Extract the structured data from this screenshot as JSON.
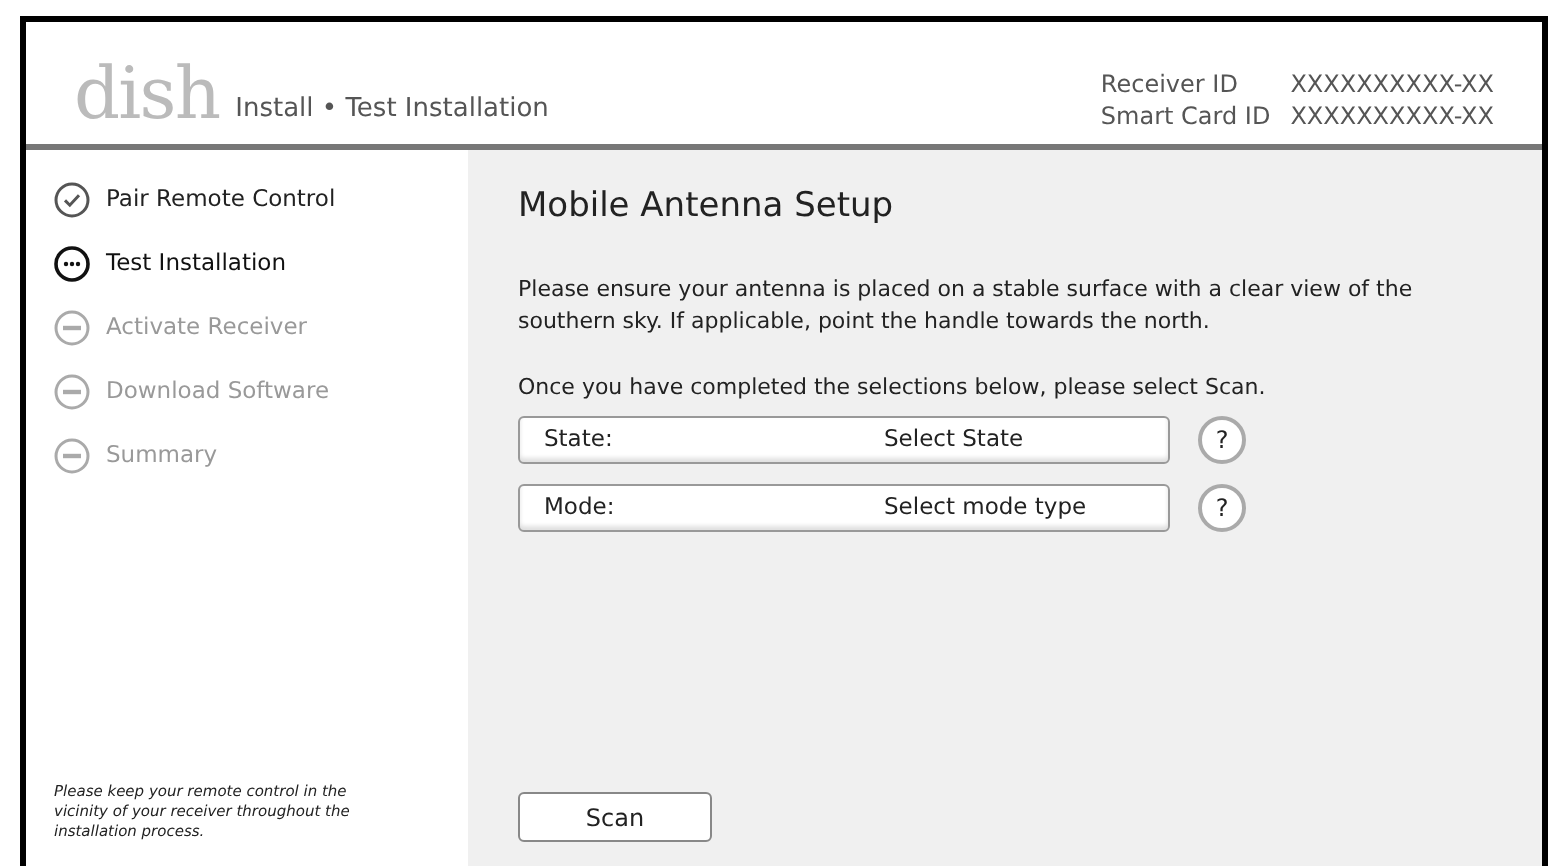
{
  "header": {
    "logo": "dish",
    "breadcrumb": "Install • Test Installation",
    "ids": [
      {
        "label": "Receiver ID",
        "value": "XXXXXXXXXX-XX"
      },
      {
        "label": "Smart Card ID",
        "value": "XXXXXXXXXX-XX"
      }
    ]
  },
  "steps": [
    {
      "label": "Pair Remote Control",
      "kind": "done"
    },
    {
      "label": "Test Installation",
      "kind": "current"
    },
    {
      "label": "Activate Receiver",
      "kind": "pending"
    },
    {
      "label": "Download Software",
      "kind": "pending"
    },
    {
      "label": "Summary",
      "kind": "pending"
    }
  ],
  "sidebar_note": "Please keep your remote control in the vicinity of your receiver throughout the installation process.",
  "main": {
    "title": "Mobile Antenna Setup",
    "instructions": "Please ensure your antenna is placed on a stable surface with a clear view of the southern sky.  If applicable, point the handle towards the north.",
    "prompt": "Once you have completed the selections below, please select Scan.",
    "selects": [
      {
        "label": "State:",
        "value": "Select State",
        "help": "?"
      },
      {
        "label": "Mode:",
        "value": "Select mode type",
        "help": "?"
      }
    ],
    "button": "Scan"
  }
}
